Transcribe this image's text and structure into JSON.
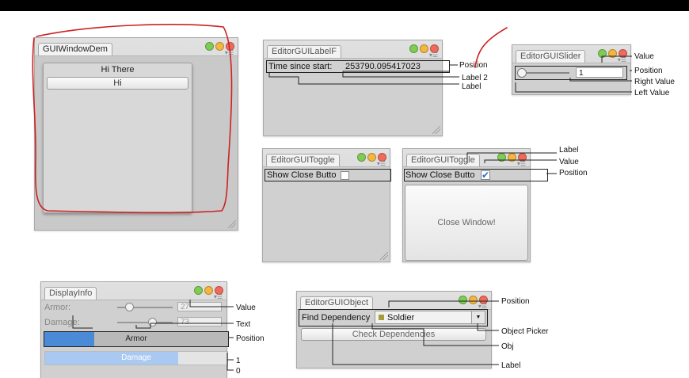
{
  "colors": {
    "annotation_red": "#cc2222",
    "track_blue": "#4a8ad6",
    "track_light": "#a9c9f2"
  },
  "gui_window": {
    "tab": "GUIWindowDem",
    "inner_title": "Hi There",
    "button": "Hi"
  },
  "label_field": {
    "tab": "EditorGUILabelF",
    "label": "Time since start:",
    "value": "253790.095417023",
    "callouts": {
      "position": "Position",
      "label2": "Label 2",
      "label": "Label"
    }
  },
  "slider": {
    "tab": "EditorGUISlider",
    "value": "1",
    "value_fraction": 0.0,
    "callouts": {
      "value": "Value",
      "position": "Position",
      "right_value": "Right Value",
      "left_value": "Left Value"
    }
  },
  "toggle_off": {
    "tab": "EditorGUIToggle",
    "label": "Show Close Butto"
  },
  "toggle_on": {
    "tab": "EditorGUIToggle",
    "label": "Show Close Butto",
    "button": "Close Window!",
    "callouts": {
      "label": "Label",
      "value": "Value",
      "position": "Position"
    }
  },
  "display_info": {
    "tab": "DisplayInfo",
    "armor": {
      "label": "Armor:",
      "value": "27",
      "fraction": 0.2
    },
    "damage": {
      "label": "Damage:",
      "value": "73",
      "fraction": 0.62
    },
    "armor_bar": {
      "text": "Armor",
      "fraction": 0.27
    },
    "damage_bar": {
      "text": "Damage",
      "fraction": 0.73
    },
    "callouts": {
      "value": "Value",
      "text": "Text",
      "position": "Position",
      "one": "1",
      "zero": "0"
    }
  },
  "object_field": {
    "tab": "EditorGUIObject",
    "label": "Find Dependency",
    "object": "Soldier",
    "button": "Check Dependencies",
    "picker_icon": "dropdown-arrow-icon",
    "callouts": {
      "position": "Position",
      "object_picker": "Object Picker",
      "obj": "Obj",
      "label": "Label"
    }
  }
}
